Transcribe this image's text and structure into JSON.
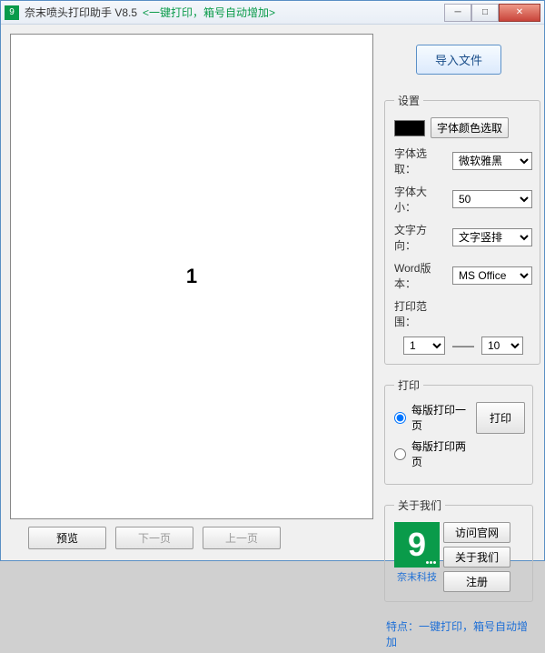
{
  "window": {
    "title": "奈末喷头打印助手 V8.5",
    "hint": "<一键打印，箱号自动增加>"
  },
  "winControls": {
    "min": "─",
    "max": "□",
    "close": "✕"
  },
  "preview": {
    "pageNumber": "1"
  },
  "leftButtons": {
    "preview": "预览",
    "next": "下一页",
    "prev": "上一页"
  },
  "importBtn": "导入文件",
  "settings": {
    "legend": "设置",
    "colorPick": "字体颜色选取",
    "fontLabel": "字体选取：",
    "fontValue": "微软雅黑",
    "sizeLabel": "字体大小：",
    "sizeValue": "50",
    "dirLabel": "文字方向：",
    "dirValue": "文字竖排",
    "wordLabel": "Word版本：",
    "wordValue": "MS Office",
    "rangeLabel": "打印范围：",
    "rangeFrom": "1",
    "rangeSep": "——",
    "rangeTo": "10"
  },
  "print": {
    "legend": "打印",
    "opt1": "每版打印一页",
    "opt2": "每版打印两页",
    "btn": "打印"
  },
  "about": {
    "legend": "关于我们",
    "caption": "奈末科技",
    "site": "访问官网",
    "aboutBtn": "关于我们",
    "register": "注册"
  },
  "feature": "特点：一键打印，箱号自动增加"
}
